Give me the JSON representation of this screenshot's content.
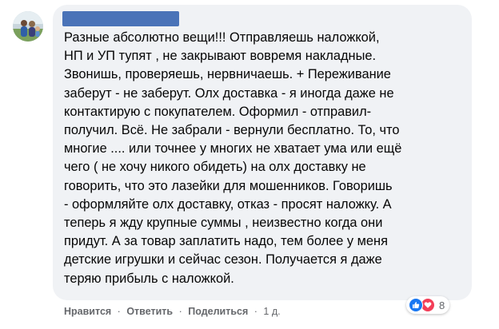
{
  "comment": {
    "author_name": "",
    "body_lines": [
      "Разные абсолютно вещи!!! Отправляешь наложкой,",
      "НП и УП тупят , не закрывают вовремя накладные.",
      "Звонишь, проверяешь, нервничаешь. + Переживание",
      "заберут - не заберут. Олх доставка - я иногда даже не",
      "контактирую с покупателем. Оформил - отправил-",
      "получил. Всё. Не забрали - вернули бесплатно. То, что",
      "многие .... или точнее у многих не хватает ума или ещё",
      "чего ( не хочу никого обидеть) на олх доставку не",
      "говорить, что это лазейки для мошенников. Говоришь",
      "- оформляйте олх доставку, отказ - просят наложку. А",
      "теперь я жду крупные суммы , неизвестно когда они",
      "придут. А за товар заплатить надо, тем более у меня",
      "детские игрушки и сейчас сезон. Получается я даже",
      "теряю прибыль с наложкой."
    ]
  },
  "actions": {
    "like_label": "Нравится",
    "reply_label": "Ответить",
    "share_label": "Поделиться",
    "separator": "·",
    "timestamp": "1 д."
  },
  "reactions": {
    "types": [
      "like-icon",
      "love-icon"
    ],
    "count": "8",
    "colors": {
      "like": "#1877f2",
      "love": "#f33e58"
    }
  },
  "colors": {
    "bubble": "#f0f2f5",
    "text": "#050505",
    "secondary_text": "#65676b",
    "redaction": "#4a73b8"
  }
}
